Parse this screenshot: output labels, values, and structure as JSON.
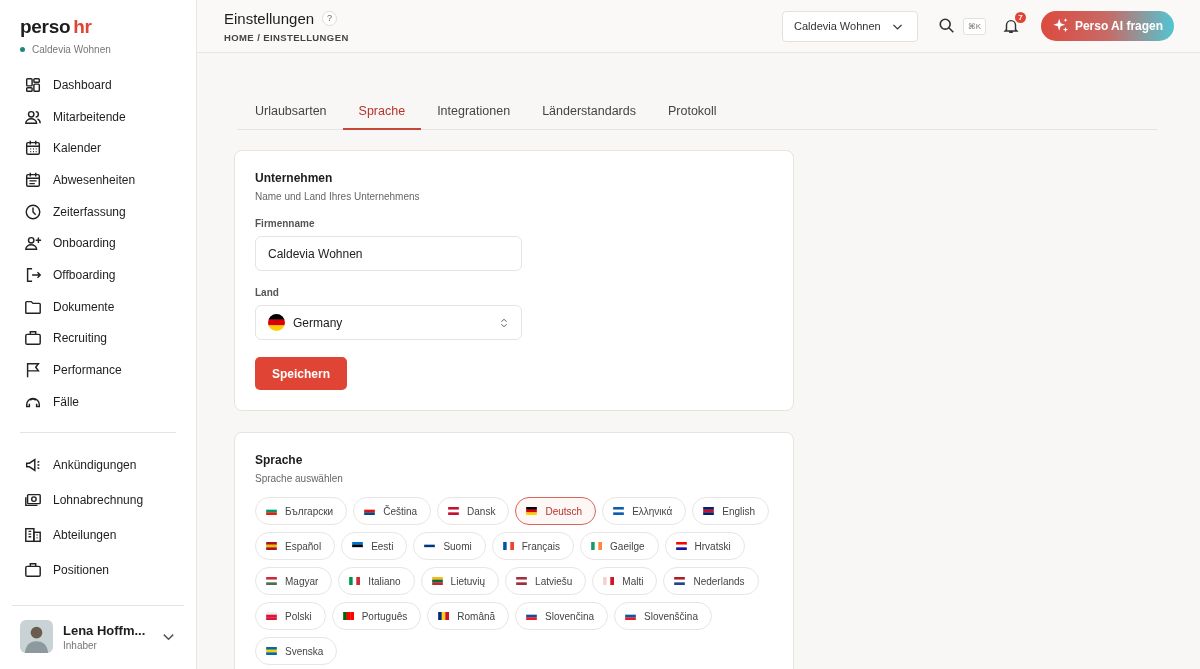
{
  "sidebar": {
    "logo": [
      "perso",
      "hr"
    ],
    "workspace": {
      "name": "Caldevia Wohnen",
      "color": "#1a8a7a"
    },
    "groups": [
      [
        "Dashboard",
        "Mitarbeitende",
        "Kalender",
        "Abwesenheiten",
        "Zeiterfassung",
        "Onboarding",
        "Offboarding",
        "Dokumente",
        "Recruiting",
        "Performance",
        "Fälle"
      ],
      [
        "Ankündigungen",
        "Lohnabrechnung",
        "Abteilungen",
        "Positionen"
      ]
    ],
    "user": {
      "name": "Lena Hoffm...",
      "role": "Inhaber"
    }
  },
  "header": {
    "title": "Einstellungen",
    "help": "?",
    "breadcrumb": "HOME / EINSTELLUNGEN",
    "company_select": "Caldevia Wohnen",
    "shortcut": "⌘K",
    "notifications": "7",
    "ai_button": "Perso AI fragen"
  },
  "tabs": [
    {
      "label": "Urlaubsarten",
      "selected": false
    },
    {
      "label": "Sprache",
      "selected": true
    },
    {
      "label": "Integrationen",
      "selected": false
    },
    {
      "label": "Länderstandards",
      "selected": false
    },
    {
      "label": "Protokoll",
      "selected": false
    }
  ],
  "company_card": {
    "title": "Unternehmen",
    "subtitle": "Name und Land Ihres Unternehmens",
    "name_label": "Firmenname",
    "name_value": "Caldevia Wohnen",
    "country_label": "Land",
    "country_value": "Germany",
    "save": "Speichern"
  },
  "language_card": {
    "title": "Sprache",
    "subtitle": "Sprache auswählen",
    "languages": [
      {
        "label": "Български",
        "selected": false
      },
      {
        "label": "Čeština",
        "selected": false
      },
      {
        "label": "Dansk",
        "selected": false
      },
      {
        "label": "Deutsch",
        "selected": true
      },
      {
        "label": "Ελληνικά",
        "selected": false
      },
      {
        "label": "English",
        "selected": false
      },
      {
        "label": "Español",
        "selected": false
      },
      {
        "label": "Eesti",
        "selected": false
      },
      {
        "label": "Suomi",
        "selected": false
      },
      {
        "label": "Français",
        "selected": false
      },
      {
        "label": "Gaeilge",
        "selected": false
      },
      {
        "label": "Hrvatski",
        "selected": false
      },
      {
        "label": "Magyar",
        "selected": false
      },
      {
        "label": "Italiano",
        "selected": false
      },
      {
        "label": "Lietuvių",
        "selected": false
      },
      {
        "label": "Latviešu",
        "selected": false
      },
      {
        "label": "Malti",
        "selected": false
      },
      {
        "label": "Nederlands",
        "selected": false
      },
      {
        "label": "Polski",
        "selected": false
      },
      {
        "label": "Português",
        "selected": false
      },
      {
        "label": "Română",
        "selected": false
      },
      {
        "label": "Slovenčina",
        "selected": false
      },
      {
        "label": "Slovenščina",
        "selected": false
      },
      {
        "label": "Svenska",
        "selected": false
      }
    ]
  }
}
